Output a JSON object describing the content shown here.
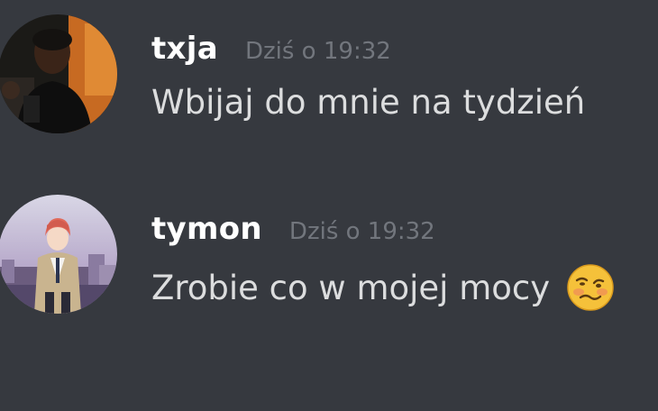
{
  "messages": [
    {
      "username": "txja",
      "timestamp": "Dziś o 19:32",
      "content": "Wbijaj do mnie na tydzień",
      "avatar_icon": "user-photo-avatar"
    },
    {
      "username": "tymon",
      "timestamp": "Dziś o 19:32",
      "content": "Zrobie co w mojej mocy",
      "avatar_icon": "anime-character-avatar",
      "emoji": "woozy-face-emoji"
    }
  ],
  "colors": {
    "background": "#36393f",
    "username": "#ffffff",
    "timestamp": "#72767d",
    "content": "#dcddde"
  }
}
